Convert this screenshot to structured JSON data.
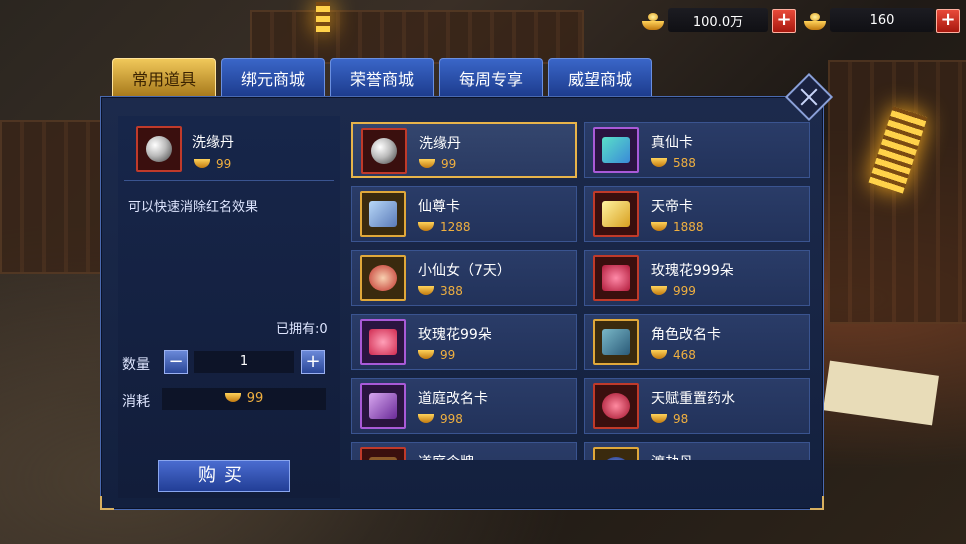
{
  "currency": {
    "gold": {
      "value": "100.0万",
      "icon": "gold-ingot-icon"
    },
    "bound_gold": {
      "value": "160",
      "icon": "bound-ingot-icon"
    }
  },
  "tabs": [
    {
      "label": "常用道具",
      "active": true
    },
    {
      "label": "绑元商城",
      "active": false
    },
    {
      "label": "荣誉商城",
      "active": false
    },
    {
      "label": "每周专享",
      "active": false
    },
    {
      "label": "威望商城",
      "active": false
    }
  ],
  "detail": {
    "name": "洗缘丹",
    "price": "99",
    "description": "可以快速消除红名效果",
    "owned": "已拥有:0",
    "qty_label": "数量",
    "qty_value": "1",
    "cost_label": "消耗",
    "cost_value": "99",
    "buy_label": "购买"
  },
  "items": [
    {
      "name": "洗缘丹",
      "price": "99",
      "icon": "pearl-icon",
      "selected": true
    },
    {
      "name": "真仙卡",
      "price": "588",
      "icon": "immortal-card-icon"
    },
    {
      "name": "仙尊卡",
      "price": "1288",
      "icon": "lord-card-icon"
    },
    {
      "name": "天帝卡",
      "price": "1888",
      "icon": "emperor-card-icon"
    },
    {
      "name": "小仙女（7天）",
      "price": "388",
      "icon": "fairy-portrait-icon"
    },
    {
      "name": "玫瑰花999朵",
      "price": "999",
      "icon": "rose-basket-icon"
    },
    {
      "name": "玫瑰花99朵",
      "price": "99",
      "icon": "rose-bouquet-icon"
    },
    {
      "name": "角色改名卡",
      "price": "468",
      "icon": "rename-card-icon"
    },
    {
      "name": "道庭改名卡",
      "price": "998",
      "icon": "guild-rename-card-icon"
    },
    {
      "name": "天赋重置药水",
      "price": "98",
      "icon": "potion-icon"
    },
    {
      "name": "道庭令牌",
      "price": "",
      "icon": "token-icon"
    },
    {
      "name": "渡劫丹",
      "price": "",
      "icon": "pill-icon"
    }
  ]
}
